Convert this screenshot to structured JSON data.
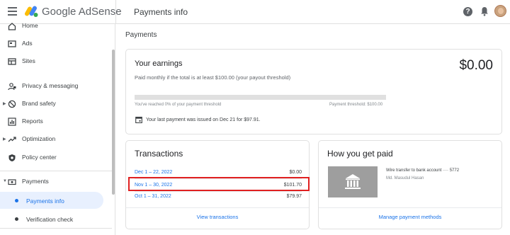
{
  "header": {
    "brand": "Google AdSense",
    "page_title": "Payments info",
    "help_glyph": "?"
  },
  "sidebar": {
    "items": [
      {
        "label": "Home",
        "icon": "home-icon"
      },
      {
        "label": "Ads",
        "icon": "ads-icon"
      },
      {
        "label": "Sites",
        "icon": "sites-icon"
      },
      {
        "label": "Privacy & messaging",
        "icon": "privacy-icon"
      },
      {
        "label": "Brand safety",
        "icon": "block-icon"
      },
      {
        "label": "Reports",
        "icon": "reports-icon"
      },
      {
        "label": "Optimization",
        "icon": "trending-icon"
      },
      {
        "label": "Policy center",
        "icon": "shield-icon"
      },
      {
        "label": "Payments",
        "icon": "payments-icon"
      }
    ],
    "sub_items": [
      {
        "label": "Payments info",
        "active": true
      },
      {
        "label": "Verification check",
        "active": false
      }
    ]
  },
  "main": {
    "heading": "Payments",
    "earnings": {
      "title": "Your earnings",
      "amount": "$0.00",
      "subtitle": "Paid monthly if the total is at least $100.00 (your payout threshold)",
      "progress_fraction": 0,
      "progress_left": "You've reached 0% of your payment threshold",
      "progress_right": "Payment threshold: $100.00",
      "last_payment": "Your last payment was issued on Dec 21 for $97.91."
    },
    "transactions": {
      "title": "Transactions",
      "rows": [
        {
          "date": "Dec 1 – 22, 2022",
          "amount": "$0.00"
        },
        {
          "date": "Nov 1 – 30, 2022",
          "amount": "$101.70"
        },
        {
          "date": "Oct 1 – 31, 2022",
          "amount": "$79.97"
        }
      ],
      "link": "View transactions"
    },
    "payment_method": {
      "title": "How you get paid",
      "description": "Wire transfer to bank account ···· 5772",
      "holder": "Md. Masudul Hasan",
      "link": "Manage payment methods"
    }
  },
  "colors": {
    "accent": "#1a73e8",
    "highlight": "#e02020",
    "active_bg": "#e8f0fe"
  }
}
